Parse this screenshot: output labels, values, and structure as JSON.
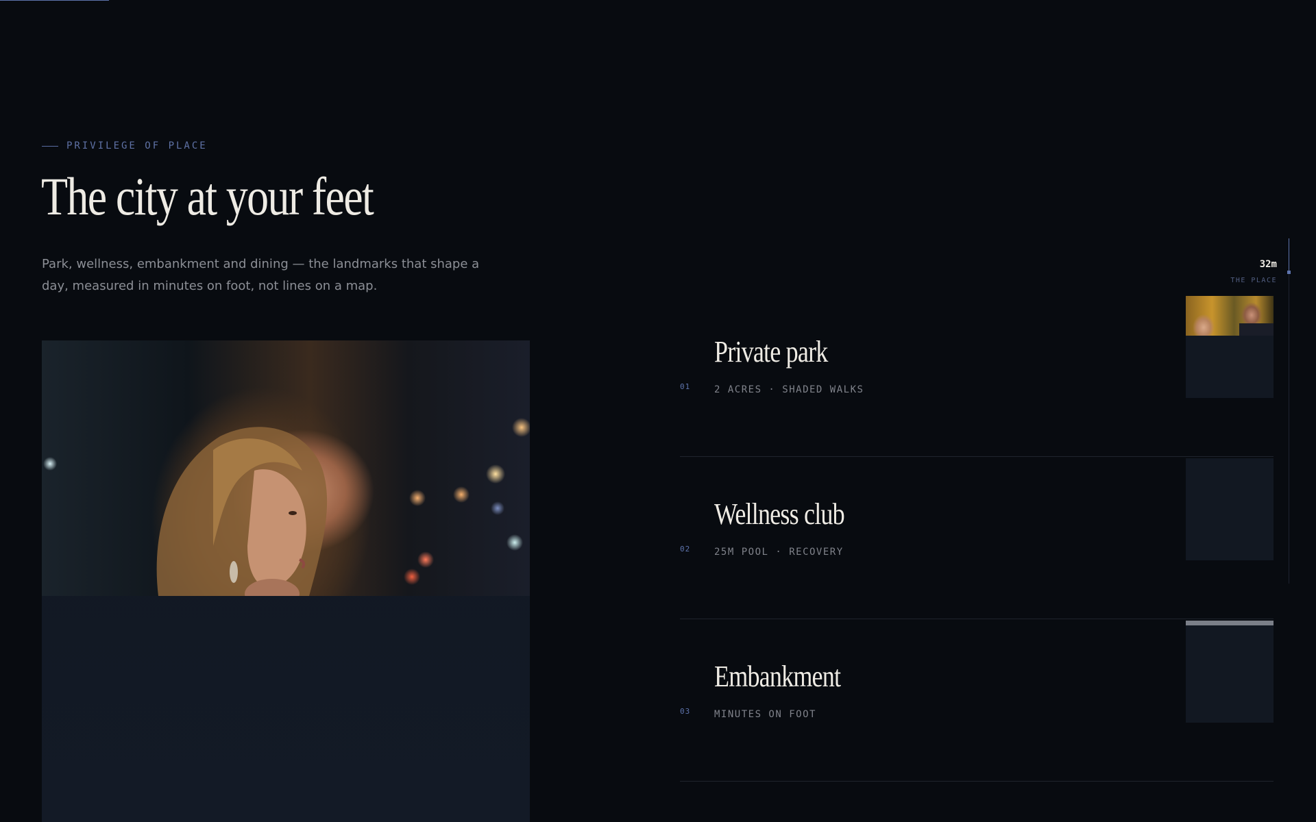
{
  "progress": {
    "fraction": 0.083
  },
  "eyebrow": {
    "text": "PRIVILEGE OF PLACE"
  },
  "hero": {
    "title": "The city at your feet",
    "lead": "Park, wellness, embankment and dining — the landmarks that shape a day, measured in minutes on foot, not lines on a map.",
    "image_icon": "woman-in-car-photo"
  },
  "tracker": {
    "distance": "32m",
    "label": "THE PLACE"
  },
  "places": [
    {
      "number": "01",
      "name": "Private park",
      "meta": "2 ACRES · SHADED WALKS",
      "thumb": "couple-photo"
    },
    {
      "number": "02",
      "name": "Wellness club",
      "meta": "25M POOL · RECOVERY",
      "thumb": "placeholder"
    },
    {
      "number": "03",
      "name": "Embankment",
      "meta": "MINUTES ON FOOT",
      "thumb": "placeholder-loading"
    }
  ],
  "colors": {
    "background": "#080b10",
    "accent": "#5e74ad",
    "text": "#eeebe4",
    "muted": "#8c8f96"
  }
}
